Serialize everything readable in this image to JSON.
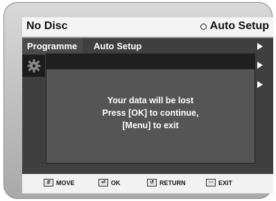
{
  "header": {
    "status": "No Disc",
    "mode_icon": "radio-circle-icon",
    "mode_label": "Auto Setup"
  },
  "menu": {
    "active_tab": "Programme",
    "current_item": "Auto Setup",
    "side_icon": "gear-icon"
  },
  "dialog": {
    "line1": "Your data will be lost",
    "line2": "Press [OK] to continue,",
    "line3": "[Menu] to exit"
  },
  "footer": {
    "move_label": "MOVE",
    "ok_label": "OK",
    "return_label": "RETURN",
    "exit_label": "EXIT"
  }
}
